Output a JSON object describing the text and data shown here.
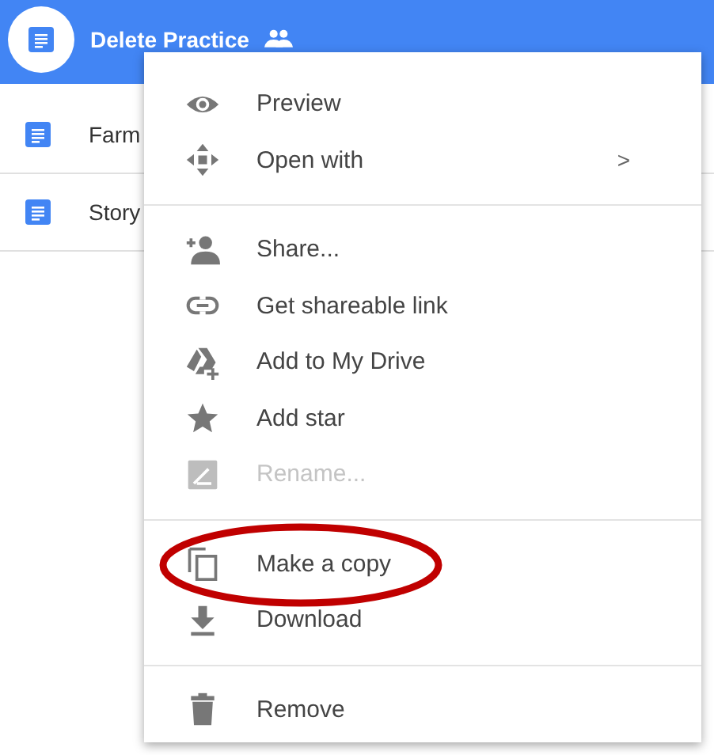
{
  "files": [
    {
      "name": "Delete Practice",
      "selected": true,
      "shared": true
    },
    {
      "name": "Farm",
      "selected": false
    },
    {
      "name": "Story",
      "selected": false
    }
  ],
  "context_menu": {
    "groups": [
      [
        {
          "label": "Preview",
          "disabled": false,
          "highlighted": false
        },
        {
          "label": "Open with",
          "disabled": false,
          "highlighted": false,
          "submenu_arrow": ">"
        }
      ],
      [
        {
          "label": "Share...",
          "disabled": false,
          "highlighted": false
        },
        {
          "label": "Get shareable link",
          "disabled": false,
          "highlighted": false
        },
        {
          "label": "Add to My Drive",
          "disabled": false,
          "highlighted": false
        },
        {
          "label": "Add star",
          "disabled": false,
          "highlighted": false
        },
        {
          "label": "Rename...",
          "disabled": true,
          "highlighted": false
        }
      ],
      [
        {
          "label": "Make a copy",
          "disabled": false,
          "highlighted": true
        },
        {
          "label": "Download",
          "disabled": false,
          "highlighted": false
        }
      ],
      [
        {
          "label": "Remove",
          "disabled": false,
          "highlighted": false
        }
      ]
    ]
  }
}
